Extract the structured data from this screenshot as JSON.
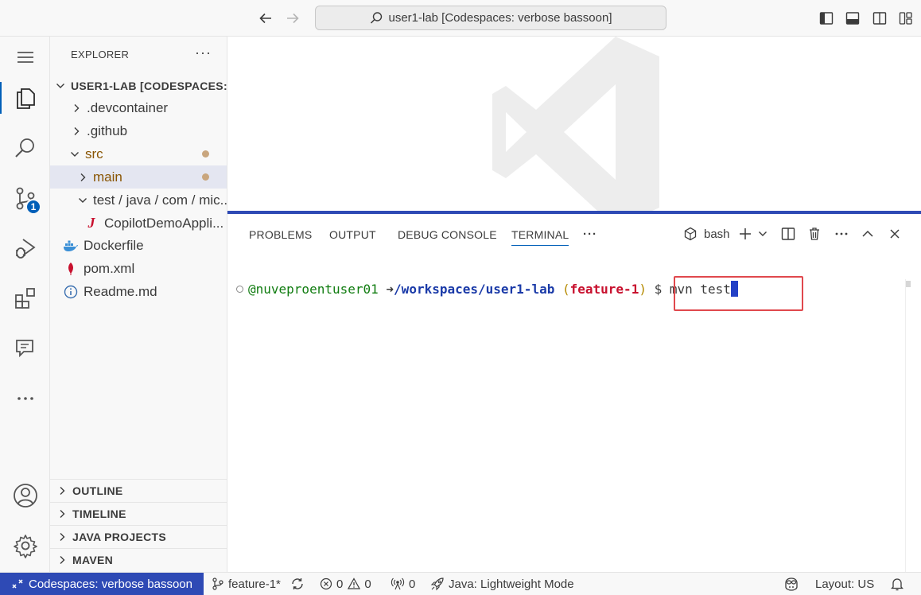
{
  "titlebar": {
    "search_text": "user1-lab [Codespaces: verbose bassoon]"
  },
  "activity_bar": {
    "source_control_badge": "1"
  },
  "explorer": {
    "title": "EXPLORER",
    "more": "···",
    "root": "USER1-LAB [CODESPACES:...",
    "items": [
      {
        "label": ".devcontainer"
      },
      {
        "label": ".github"
      },
      {
        "label": "src"
      },
      {
        "label": "main"
      },
      {
        "label": "test / java / com / mic..."
      },
      {
        "label": "CopilotDemoAppli..."
      },
      {
        "label": "Dockerfile"
      },
      {
        "label": "pom.xml"
      },
      {
        "label": "Readme.md"
      }
    ],
    "sections": [
      {
        "label": "OUTLINE"
      },
      {
        "label": "TIMELINE"
      },
      {
        "label": "JAVA PROJECTS"
      },
      {
        "label": "MAVEN"
      }
    ]
  },
  "panel": {
    "tabs": [
      {
        "label": "PROBLEMS"
      },
      {
        "label": "OUTPUT"
      },
      {
        "label": "DEBUG CONSOLE"
      },
      {
        "label": "TERMINAL"
      }
    ],
    "active_tab": "TERMINAL",
    "more": "···",
    "shell": "bash",
    "terminal": {
      "user": "@nuveproentuser01",
      "arrow": "➜",
      "path": "/workspaces/user1-lab",
      "branch_open": "(",
      "branch": "feature-1",
      "branch_close": ")",
      "command": "$ mvn test"
    }
  },
  "statusbar": {
    "remote": "Codespaces: verbose bassoon",
    "branch": "feature-1*",
    "errors": "0",
    "warnings": "0",
    "ports": "0",
    "java": "Java: Lightweight Mode",
    "layout": "Layout: US"
  },
  "colors": {
    "accent": "#005fb8",
    "remote_bg": "#2e4ab5",
    "highlight_box": "#e0484d"
  }
}
